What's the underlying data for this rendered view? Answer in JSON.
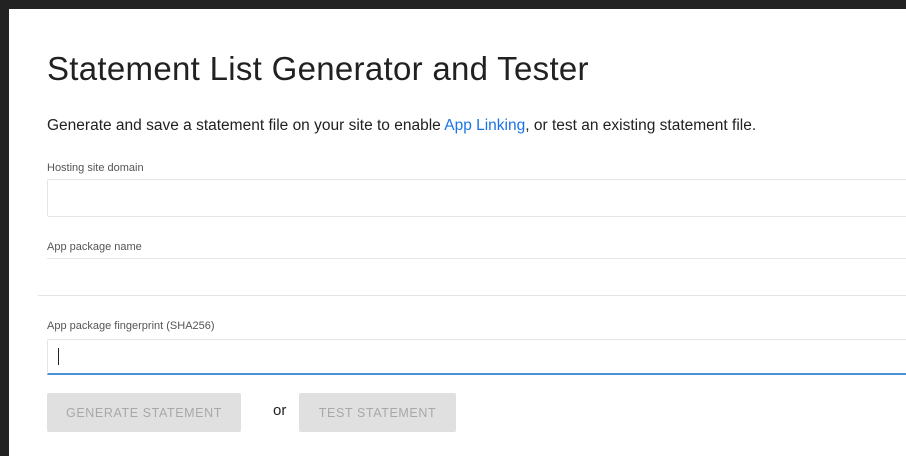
{
  "page": {
    "title": "Statement List Generator and Tester",
    "intro_before": "Generate and save a statement file on your site to enable ",
    "intro_link": "App Linking",
    "intro_after": ", or test an existing statement file."
  },
  "form": {
    "hosting_site_domain": {
      "label": "Hosting site domain",
      "value": ""
    },
    "app_package_name": {
      "label": "App package name",
      "value": ""
    },
    "app_package_fingerprint": {
      "label": "App package fingerprint (SHA256)",
      "value": ""
    }
  },
  "actions": {
    "generate_label": "GENERATE STATEMENT",
    "or_text": "or",
    "test_label": "TEST STATEMENT"
  },
  "colors": {
    "link": "#1a73e8",
    "focus_underline": "#4a90d9",
    "button_disabled_bg": "#e0e0e0",
    "button_disabled_text": "#a8a8a8",
    "frame_border": "#222222"
  }
}
